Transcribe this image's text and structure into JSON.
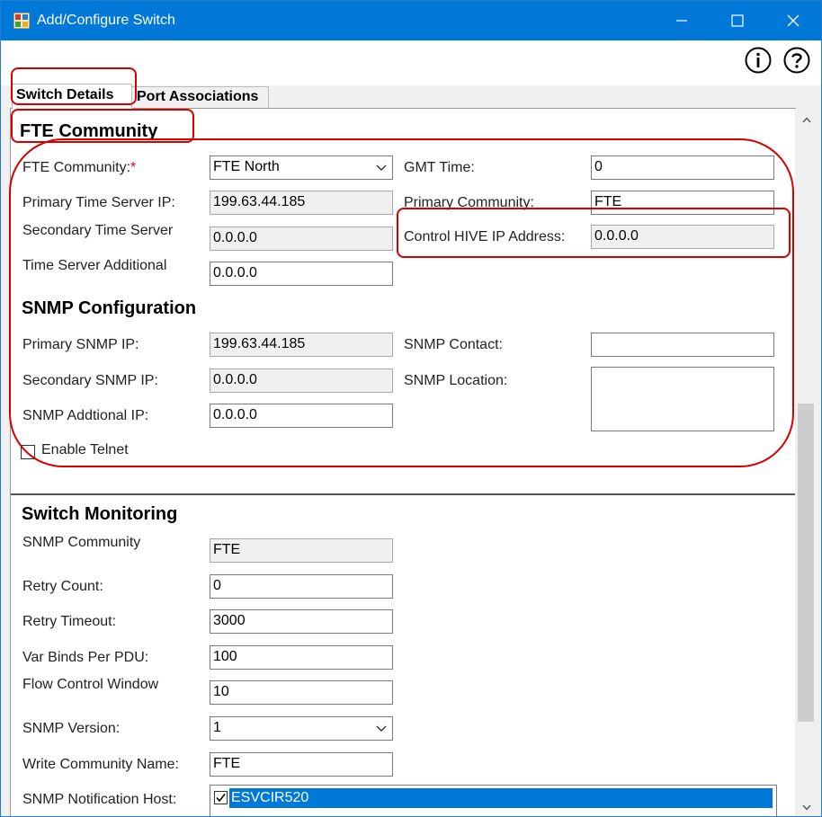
{
  "window": {
    "title": "Add/Configure Switch",
    "controls": {
      "minimize_icon": "minimize-icon",
      "maximize_icon": "maximize-icon",
      "close_icon": "close-icon"
    }
  },
  "toolbar": {
    "info_icon": "info-icon",
    "help_icon": "help-icon"
  },
  "tabs": [
    {
      "label": "Switch Details",
      "active": true
    },
    {
      "label": "Port Associations",
      "active": false
    }
  ],
  "fte_community": {
    "heading": "FTE Community",
    "fte_community_label": "FTE Community:",
    "required_mark": "*",
    "fte_community_value": "FTE North",
    "gmt_time_label": "GMT Time:",
    "gmt_time_value": "0",
    "primary_time_server_label": "Primary Time Server IP:",
    "primary_time_server_value": "199.63.44.185",
    "primary_community_label": "Primary Community:",
    "primary_community_value": "FTE",
    "secondary_time_server_label": "Secondary Time Server",
    "secondary_time_server_value": "0.0.0.0",
    "control_hive_label": "Control HIVE IP Address:",
    "control_hive_value": "0.0.0.0",
    "time_server_additional_label": "Time Server Additional",
    "time_server_additional_value": "0.0.0.0"
  },
  "snmp_configuration": {
    "heading": "SNMP Configuration",
    "primary_snmp_ip_label": "Primary SNMP IP:",
    "primary_snmp_ip_value": "199.63.44.185",
    "snmp_contact_label": "SNMP Contact:",
    "snmp_contact_value": "",
    "secondary_snmp_ip_label": "Secondary SNMP IP:",
    "secondary_snmp_ip_value": "0.0.0.0",
    "snmp_location_label": "SNMP Location:",
    "snmp_location_value": "",
    "snmp_additional_ip_label": "SNMP Addtional IP:",
    "snmp_additional_ip_value": "0.0.0.0",
    "enable_telnet_label": "Enable Telnet",
    "enable_telnet_checked": false
  },
  "switch_monitoring": {
    "heading": "Switch Monitoring",
    "snmp_community_label": "SNMP Community",
    "snmp_community_value": "FTE",
    "retry_count_label": "Retry Count:",
    "retry_count_value": "0",
    "retry_timeout_label": "Retry Timeout:",
    "retry_timeout_value": "3000",
    "var_binds_label": "Var Binds Per PDU:",
    "var_binds_value": "100",
    "flow_control_label": "Flow Control Window",
    "flow_control_value": "10",
    "snmp_version_label": "SNMP Version:",
    "snmp_version_value": "1",
    "write_community_label": "Write Community Name:",
    "write_community_value": "FTE",
    "notification_host_label": "SNMP Notification Host:",
    "notification_hosts": [
      {
        "name": "ESVCIR520",
        "checked": true,
        "selected": true
      }
    ]
  },
  "colors": {
    "titlebar": "#0078d7",
    "selection": "#0078d7",
    "annotation": "#d60000",
    "required": "#e00000",
    "readonly_field": "#f0f0f0"
  }
}
